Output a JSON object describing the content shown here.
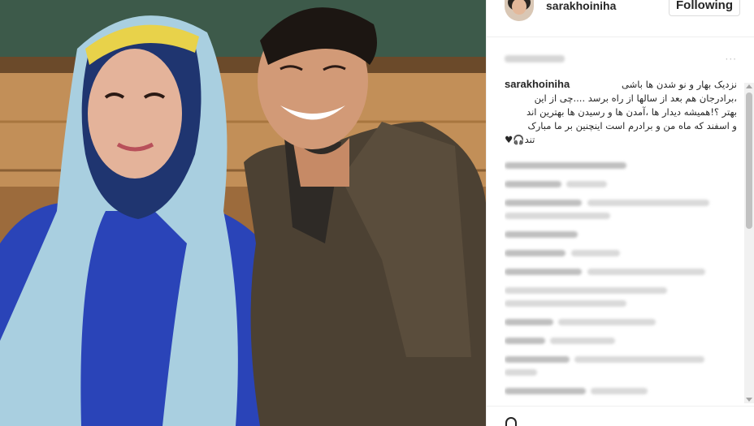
{
  "post": {
    "username": "sarakhoiniha",
    "follow_label": "Following",
    "caption_user": "sarakhoiniha",
    "caption_lines": [
      "نزدیک بهار و نو شدن ها باشی",
      "،برادرجان هم بعد از سالها از راه برسد ....چی از این",
      "بهتر ؟!همیشه دیدار ها ،آمدن ها و رسیدن ها بهترین اند",
      "و اسفند که ماه من و برادرم است اینچنین بر ما مبارک",
      "تند🎧♥"
    ]
  },
  "icons": {
    "avatar": "profile-avatar",
    "more": "more-options-icon",
    "like": "heart-icon"
  },
  "colors": {
    "background": "#ffffff",
    "border": "#efefef",
    "text": "#262626"
  }
}
